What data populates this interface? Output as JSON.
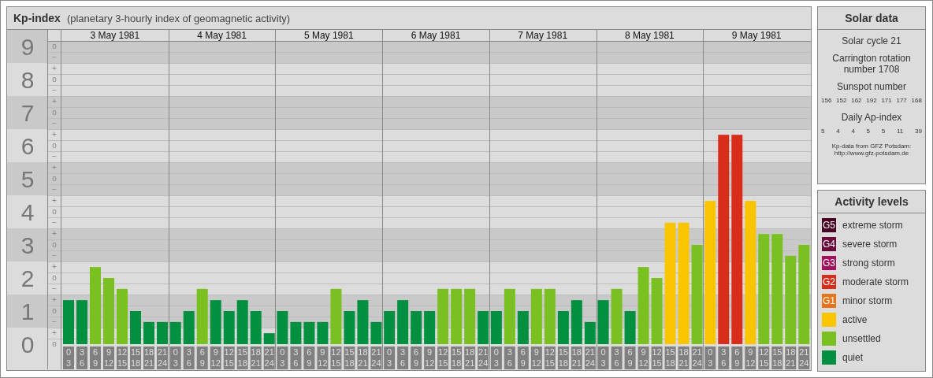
{
  "header": {
    "title": "Kp-index",
    "subtitle": "(planetary 3-hourly index of geomagnetic activity)"
  },
  "y_axis": [
    {
      "label": "9",
      "marks": [
        "o",
        "−"
      ]
    },
    {
      "label": "8",
      "marks": [
        "+",
        "o",
        "−"
      ]
    },
    {
      "label": "7",
      "marks": [
        "+",
        "o",
        "−"
      ]
    },
    {
      "label": "6",
      "marks": [
        "+",
        "o",
        "−"
      ]
    },
    {
      "label": "5",
      "marks": [
        "+",
        "o",
        "−"
      ]
    },
    {
      "label": "4",
      "marks": [
        "+",
        "o",
        "−"
      ]
    },
    {
      "label": "3",
      "marks": [
        "+",
        "o",
        "−"
      ]
    },
    {
      "label": "2",
      "marks": [
        "+",
        "o",
        "−"
      ]
    },
    {
      "label": "1",
      "marks": [
        "+",
        "o",
        "−"
      ]
    },
    {
      "label": "0",
      "marks": [
        "+",
        "o"
      ]
    }
  ],
  "days": [
    {
      "date": "3 May 1981",
      "slot_ends": [
        "3",
        "6",
        "9",
        "12",
        "15",
        "18",
        "21",
        "24"
      ]
    },
    {
      "date": "4 May 1981",
      "slot_ends": [
        "3",
        "6",
        "9",
        "12",
        "15",
        "18",
        "21",
        "24"
      ]
    },
    {
      "date": "5 May 1981",
      "slot_ends": [
        "3",
        "6",
        "9",
        "12",
        "15",
        "18",
        "21",
        "24"
      ]
    },
    {
      "date": "6 May 1981",
      "slot_ends": [
        "3",
        "6",
        "9",
        "12",
        "15",
        "18",
        "21",
        "24"
      ]
    },
    {
      "date": "7 May 1981",
      "slot_ends": [
        "3",
        "6",
        "9",
        "12",
        "15",
        "18",
        "21",
        "24"
      ]
    },
    {
      "date": "8 May 1981",
      "slot_ends": [
        "3",
        "6",
        "9",
        "12",
        "15",
        "18",
        "21",
        "24"
      ]
    },
    {
      "date": "9 May 1981",
      "slot_ends": [
        "3",
        "6",
        "9",
        "12",
        "15",
        "18",
        "21",
        "24"
      ]
    }
  ],
  "chart_data": {
    "type": "bar",
    "categories": [
      "0",
      "3",
      "6",
      "9",
      "12",
      "15",
      "18",
      "21",
      "0",
      "3",
      "6",
      "9",
      "12",
      "15",
      "18",
      "21",
      "0",
      "3",
      "6",
      "9",
      "12",
      "15",
      "18",
      "21",
      "0",
      "3",
      "6",
      "9",
      "12",
      "15",
      "18",
      "21",
      "0",
      "3",
      "6",
      "9",
      "12",
      "15",
      "18",
      "21",
      "0",
      "3",
      "6",
      "9",
      "12",
      "15",
      "18",
      "21",
      "0",
      "3",
      "6",
      "9",
      "12",
      "15",
      "18",
      "21"
    ],
    "ylim": [
      0,
      9
    ],
    "yticks": [
      0,
      1,
      2,
      3,
      4,
      5,
      6,
      7,
      8,
      9
    ],
    "series": [
      {
        "color": "#d92d1c",
        "values": [
          null,
          null,
          null,
          null,
          null,
          null,
          null,
          null,
          null,
          null,
          null,
          null,
          null,
          null,
          null,
          null,
          null,
          null,
          null,
          null,
          null,
          null,
          null,
          null,
          null,
          null,
          null,
          null,
          null,
          null,
          null,
          null,
          null,
          null,
          null,
          null,
          null,
          null,
          null,
          null,
          null,
          null,
          null,
          null,
          null,
          null,
          null,
          null,
          null,
          6.33,
          6.33,
          null,
          null,
          null,
          null,
          null
        ]
      },
      {
        "color": "#f9c500",
        "values": [
          null,
          null,
          null,
          null,
          null,
          null,
          null,
          null,
          null,
          null,
          null,
          null,
          null,
          null,
          null,
          null,
          null,
          null,
          null,
          null,
          null,
          null,
          null,
          null,
          null,
          null,
          null,
          null,
          null,
          null,
          null,
          null,
          null,
          null,
          null,
          null,
          null,
          null,
          null,
          null,
          null,
          null,
          null,
          null,
          null,
          3.67,
          3.67,
          null,
          4.33,
          null,
          null,
          4.33,
          null,
          null,
          null,
          null
        ]
      },
      {
        "color": "#7bc021",
        "values": [
          null,
          null,
          2.33,
          2,
          1.67,
          null,
          null,
          null,
          null,
          null,
          1.67,
          null,
          null,
          null,
          null,
          null,
          null,
          null,
          null,
          null,
          1.67,
          null,
          null,
          null,
          null,
          null,
          null,
          null,
          1.67,
          1.67,
          1.67,
          null,
          null,
          1.67,
          null,
          1.67,
          1.67,
          null,
          null,
          null,
          null,
          1.67,
          null,
          2.33,
          2,
          null,
          null,
          3,
          null,
          null,
          null,
          null,
          3.33,
          3.33,
          2.67,
          3
        ]
      },
      {
        "color": "#00903f",
        "values": [
          1.33,
          1.33,
          null,
          null,
          null,
          1,
          0.67,
          0.67,
          0.67,
          1,
          null,
          1.33,
          1,
          1.33,
          1,
          0.33,
          1,
          0.67,
          0.67,
          0.67,
          null,
          1,
          1.33,
          0.67,
          1,
          1.33,
          1,
          1,
          null,
          null,
          null,
          1,
          1,
          null,
          1,
          null,
          null,
          1,
          1.33,
          0.67,
          1.33,
          null,
          1,
          null,
          null,
          null,
          null,
          null,
          null,
          null,
          null,
          null,
          null,
          null,
          null,
          null
        ]
      }
    ]
  },
  "solar_data": {
    "title": "Solar data",
    "cycle": "Solar cycle 21",
    "carrington": "Carrington rotation number 1708",
    "sunspot_heading": "Sunspot number",
    "sunspot_values": [
      "156",
      "152",
      "162",
      "192",
      "171",
      "177",
      "168"
    ],
    "ap_heading": "Daily Ap-index",
    "ap_values": [
      "5",
      "4",
      "4",
      "5",
      "5",
      "11",
      "39"
    ],
    "credit": "Kp-data from GFZ Potsdam:",
    "credit_url": "http://www.gfz-potsdam.de"
  },
  "activity_levels": {
    "title": "Activity levels",
    "items": [
      {
        "kind": "level",
        "badge": "G5",
        "label": "extreme storm",
        "color": "#4a0022"
      },
      {
        "kind": "level",
        "badge": "G4",
        "label": "severe storm",
        "color": "#6d0a3c"
      },
      {
        "kind": "level",
        "badge": "G3",
        "label": "strong storm",
        "color": "#a5105c"
      },
      {
        "kind": "level",
        "badge": "G2",
        "label": "moderate storm",
        "color": "#d92d1c"
      },
      {
        "kind": "level",
        "badge": "G1",
        "label": "minor storm",
        "color": "#e8741a"
      },
      {
        "kind": "level",
        "label": "active",
        "color": "#f9c500"
      },
      {
        "kind": "level",
        "label": "unsettled",
        "color": "#7bc021"
      },
      {
        "kind": "level",
        "label": "quiet",
        "color": "#00903f"
      }
    ]
  }
}
